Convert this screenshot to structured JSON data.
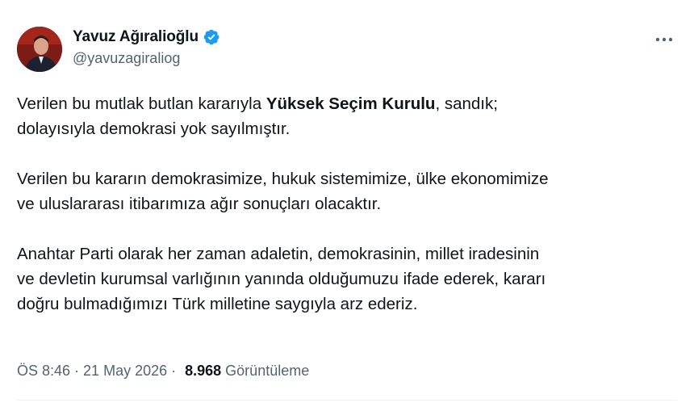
{
  "author": {
    "display_name": "Yavuz Ağıralioğlu",
    "handle": "@yavuzagiraliog",
    "verified": true,
    "verified_color": "#1d9bf0"
  },
  "icons": {
    "verified": "verified-badge-icon",
    "more": "more-horizontal-icon"
  },
  "tweet": {
    "p1": {
      "a": "Verilen bu mutlak butlan kararıyla ",
      "b": "Yüksek Seçim Kurulu",
      "c": ", sandık;",
      "d": "dolayısıyla demokrasi yok sayılmıştır."
    },
    "p2": {
      "l1": "Verilen bu kararın demokrasimize, hukuk sistemimize, ülke ekonomimize",
      "l2": "ve uluslararası itibarımıza ağır sonuçları olacaktır."
    },
    "p3": {
      "l1": "Anahtar Parti olarak her zaman adaletin, demokrasinin, millet iradesinin",
      "l2": "ve devletin kurumsal varlığının yanında olduğumuzu ifade ederek, kararı",
      "l3": "doğru bulmadığımızı Türk milletine saygıyla arz ederiz."
    }
  },
  "meta": {
    "time": "ÖS 8:46",
    "separator": "·",
    "date": "21 May 2026",
    "views": "8.968",
    "views_label": "Görüntüleme"
  }
}
